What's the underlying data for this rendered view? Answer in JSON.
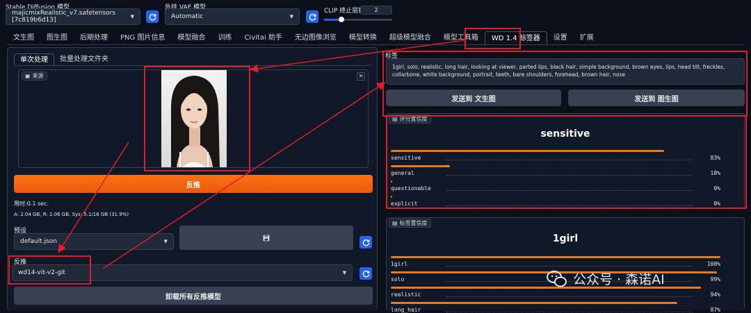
{
  "header": {
    "sd_model_label": "Stable Diffusion 模型",
    "sd_model_value": "majicmixRealistic_v7.safetensors [7c819b6d13]",
    "vae_label": "外挂 VAE 模型",
    "vae_value": "Automatic",
    "clip_label": "CLIP 终止层数",
    "clip_value": "2",
    "clip_fraction": 0.25
  },
  "tabs": [
    {
      "label": "文生图"
    },
    {
      "label": "图生图"
    },
    {
      "label": "后期处理"
    },
    {
      "label": "PNG 图片信息"
    },
    {
      "label": "模型融合"
    },
    {
      "label": "训练"
    },
    {
      "label": "Civitai 助手"
    },
    {
      "label": "无边图像浏览"
    },
    {
      "label": "模型转换"
    },
    {
      "label": "超级模型融合"
    },
    {
      "label": "模型工具箱"
    },
    {
      "label": "WD 1.4 标签器"
    },
    {
      "label": "设置"
    },
    {
      "label": "扩展"
    }
  ],
  "left": {
    "subtab_single": "单次处理",
    "subtab_batch": "批量处理文件夹",
    "source_label": "来源",
    "close_glyph": "×",
    "interrogate_button": "反推",
    "time_text": "用时:0.1 sec.",
    "mem_text": "A: 2.04 GB, R: 2.06 GB, Sys: 5.1/16 GB (31.9%)",
    "preset_label": "预设",
    "preset_value": "default.json",
    "interrogator_label": "反推",
    "interrogator_value": "wd14-vit-v2-git",
    "unload_button": "卸载所有反推模型"
  },
  "right": {
    "tags_label": "标签",
    "tags_text": "1girl, solo, realistic, long hair, looking at viewer, parted lips, black hair, simple background, brown eyes, lips, head tilt, freckles, collarbone, white background, portrait, teeth, bare shoulders, forehead, brown hair, nose",
    "send_txt2img": "发送到 文生图",
    "send_img2img": "发送到 图生图",
    "rating_label": "评分置信度",
    "rating_title": "sensitive",
    "ratings": [
      {
        "name": "sensitive",
        "pct": "83%",
        "value": 0.83
      },
      {
        "name": "general",
        "pct": "18%",
        "value": 0.18
      },
      {
        "name": "questionable",
        "pct": "0%",
        "value": 0.0
      },
      {
        "name": "explicit",
        "pct": "0%",
        "value": 0.0
      }
    ],
    "tag_conf_label": "标签置信度",
    "tag_conf_title": "1girl",
    "tag_confs": [
      {
        "name": "1girl",
        "pct": "100%",
        "value": 1.0
      },
      {
        "name": "solo",
        "pct": "99%",
        "value": 0.99
      },
      {
        "name": "realistic",
        "pct": "94%",
        "value": 0.94
      },
      {
        "name": "long_hair",
        "pct": "87%",
        "value": 0.87
      }
    ]
  },
  "watermark": "公众号 · 森诺AI"
}
